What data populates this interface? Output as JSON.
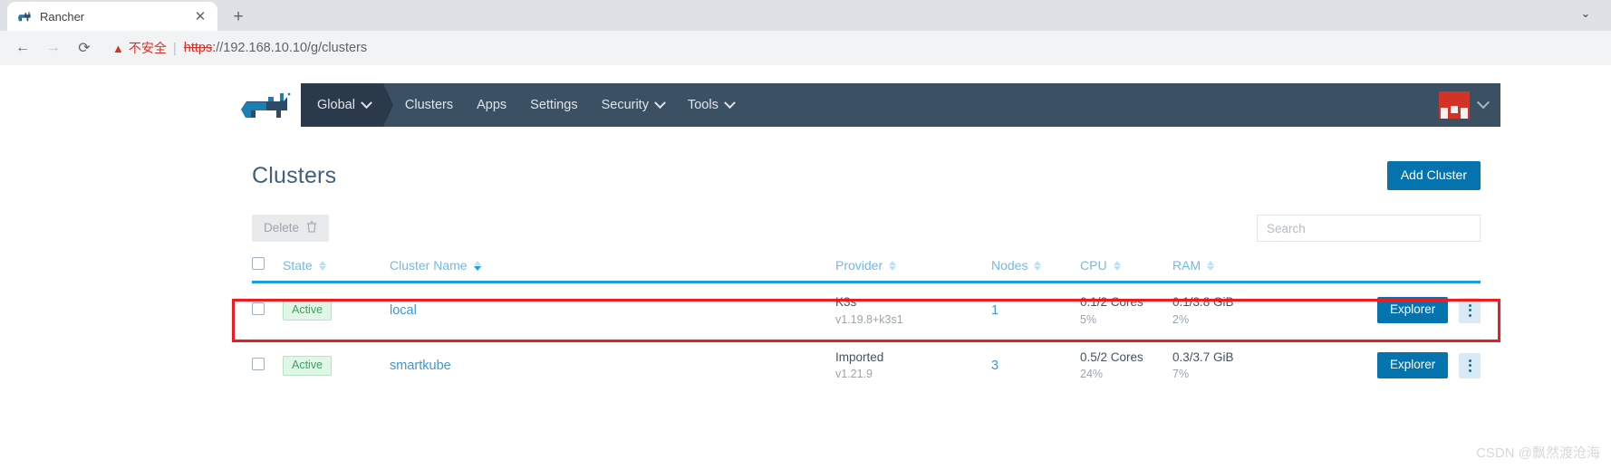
{
  "browser": {
    "tab": {
      "title": "Rancher",
      "favicon": "rancher-cow-icon",
      "close_label": "✕"
    },
    "newtab_label": "+",
    "window_minimize_label": "⌄",
    "back_label": "←",
    "forward_label": "→",
    "reload_label": "⟳",
    "security": {
      "warning_icon": "warning-triangle-icon",
      "warning_text": "不安全",
      "separator": "|"
    },
    "url": {
      "scheme": "https",
      "rest": "://192.168.10.10/g/clusters"
    }
  },
  "rancher": {
    "logo_name": "rancher-logo",
    "nav": {
      "global": "Global",
      "items": [
        "Clusters",
        "Apps",
        "Settings",
        "Security",
        "Tools"
      ],
      "dropdown_items": [
        "Security",
        "Tools"
      ],
      "avatar_name": "user-avatar"
    },
    "header": {
      "title": "Clusters",
      "add_cluster": "Add Cluster"
    },
    "toolbar": {
      "delete_label": "Delete",
      "delete_icon": "trash-icon",
      "search_placeholder": "Search",
      "search_value": ""
    },
    "table": {
      "columns": [
        {
          "key": "state",
          "label": "State",
          "sorted": false
        },
        {
          "key": "name",
          "label": "Cluster Name",
          "sorted": true
        },
        {
          "key": "provider",
          "label": "Provider",
          "sorted": false
        },
        {
          "key": "nodes",
          "label": "Nodes",
          "sorted": false
        },
        {
          "key": "cpu",
          "label": "CPU",
          "sorted": false
        },
        {
          "key": "ram",
          "label": "RAM",
          "sorted": false
        }
      ],
      "rows": [
        {
          "state": "Active",
          "name": "local",
          "provider": "K3s",
          "version": "v1.19.8+k3s1",
          "nodes": "1",
          "cpu_value": "0.1/2 Cores",
          "cpu_pct": "5%",
          "ram_value": "0.1/3.8 GiB",
          "ram_pct": "2%",
          "action": "Explorer",
          "highlighted": false
        },
        {
          "state": "Active",
          "name": "smartkube",
          "provider": "Imported",
          "version": "v1.21.9",
          "nodes": "3",
          "cpu_value": "0.5/2 Cores",
          "cpu_pct": "24%",
          "ram_value": "0.3/3.7 GiB",
          "ram_pct": "7%",
          "action": "Explorer",
          "highlighted": true
        }
      ]
    }
  },
  "colors": {
    "nav_bg": "#3c5064",
    "nav_global_bg": "#2b3a4a",
    "primary": "#0573ad",
    "link": "#3d98d3",
    "header_underline": "#1a9ee0",
    "badge_text": "#3aa35c",
    "badge_bg": "#e0f6e6",
    "highlight_border": "#ee1c21",
    "avatar_bg": "#d33327",
    "warning": "#d93025"
  },
  "watermark": "CSDN @飘然渡沧海"
}
